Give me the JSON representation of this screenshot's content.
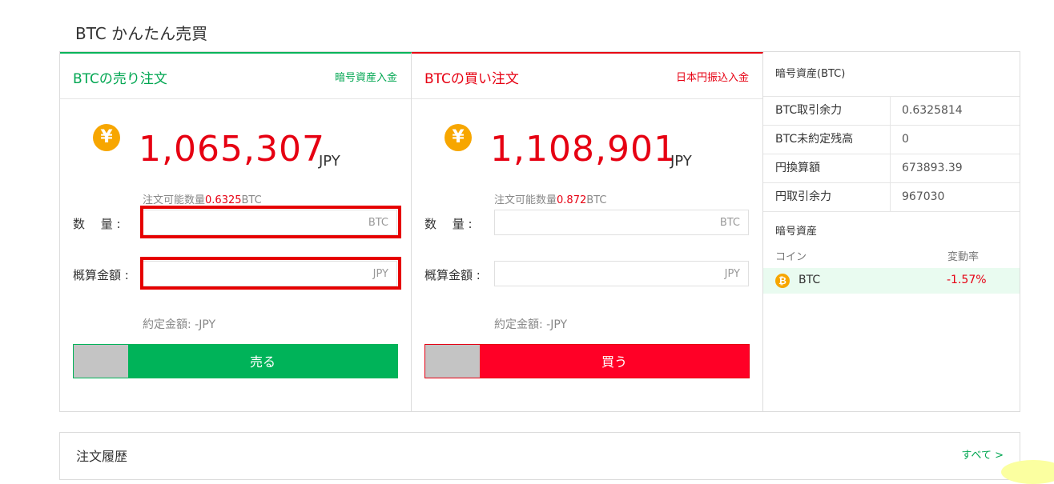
{
  "page": {
    "title": "BTC かんたん売買"
  },
  "sell": {
    "title": "BTCの売り注文",
    "link": "暗号資産入金",
    "currency_symbol": "¥",
    "price": "1,065,307",
    "price_unit": "JPY",
    "available_label": "注文可能数量",
    "available_value": "0.6325",
    "available_unit": "BTC",
    "quantity_label": "数　 量 :",
    "quantity_unit": "BTC",
    "amount_label": "概算金額 :",
    "amount_unit": "JPY",
    "settled": "約定金額: -JPY",
    "button": "売る"
  },
  "buy": {
    "title": "BTCの買い注文",
    "link": "日本円振込入金",
    "currency_symbol": "¥",
    "price": "1,108,901",
    "price_unit": "JPY",
    "available_label": "注文可能数量",
    "available_value": "0.872",
    "available_unit": "BTC",
    "quantity_label": "数　 量 :",
    "quantity_unit": "BTC",
    "amount_label": "概算金額 :",
    "amount_unit": "JPY",
    "settled": "約定金額: -JPY",
    "button": "買う"
  },
  "info": {
    "header": "暗号資産(BTC)",
    "rows": [
      {
        "label": "BTC取引余力",
        "value": "0.6325814"
      },
      {
        "label": "BTC未約定残高",
        "value": "0"
      },
      {
        "label": "円換算額",
        "value": "673893.39"
      },
      {
        "label": "円取引余力",
        "value": "967030"
      }
    ],
    "assets_title": "暗号資産",
    "col_coin": "コイン",
    "col_change": "変動率",
    "asset": {
      "icon": "₿",
      "name": "BTC",
      "change": "-1.57%"
    }
  },
  "history": {
    "title": "注文履歴",
    "link": "すべて >"
  },
  "colors": {
    "sell": "#00b359",
    "buy": "#e60012",
    "highlight": "#e60000"
  }
}
